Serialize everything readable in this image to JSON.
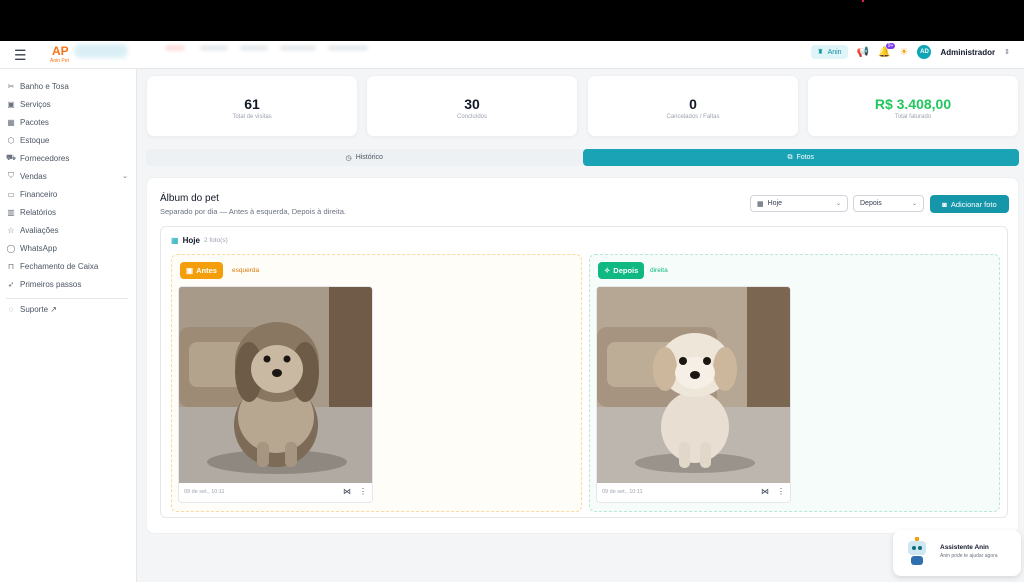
{
  "header": {
    "menu_icon": "menu-icon",
    "logo_mark": "AP",
    "logo_sub": "Anin Pet",
    "anin_chip": "Anin",
    "notif_badge": "9+",
    "avatar_initials": "AD",
    "user_name": "Administrador"
  },
  "sidebar": {
    "items": [
      {
        "label": "Banho e Tosa",
        "icon": "scissors-icon"
      },
      {
        "label": "Serviços",
        "icon": "briefcase-icon"
      },
      {
        "label": "Pacotes",
        "icon": "calendar-icon"
      },
      {
        "label": "Estoque",
        "icon": "box-icon"
      },
      {
        "label": "Fornecedores",
        "icon": "truck-icon"
      },
      {
        "label": "Vendas",
        "icon": "cart-icon"
      },
      {
        "label": "Financeiro",
        "icon": "document-icon"
      },
      {
        "label": "Relatórios",
        "icon": "bar-chart-icon"
      },
      {
        "label": "Avaliações",
        "icon": "star-icon"
      },
      {
        "label": "WhatsApp",
        "icon": "whatsapp-icon"
      },
      {
        "label": "Fechamento de Caixa",
        "icon": "cash-register-icon"
      },
      {
        "label": "Primeiros passos",
        "icon": "rocket-icon"
      }
    ],
    "support": "Suporte ↗"
  },
  "stats": [
    {
      "value": "61",
      "label": "Total de visitas"
    },
    {
      "value": "30",
      "label": "Concluídos"
    },
    {
      "value": "0",
      "label": "Cancelados / Faltas"
    },
    {
      "value": "R$ 3.408,00",
      "label": "Total faturado"
    }
  ],
  "tabs": {
    "historico": "Histórico",
    "fotos": "Fotos"
  },
  "album": {
    "title": "Álbum do pet",
    "subtitle": "Separado por dia — Antes à esquerda, Depois à direita.",
    "filter_day": "Hoje",
    "filter_type": "Depois",
    "add_button": "Adicionar foto",
    "day_label": "Hoje",
    "day_count": "2 foto(s)",
    "antes": {
      "tag": "Antes",
      "side": "esquerda",
      "timestamp": "09 de set., 10:11"
    },
    "depois": {
      "tag": "Depois",
      "side": "direita",
      "timestamp": "09 de set., 10:11"
    }
  },
  "assistant": {
    "name": "Assistente Anin",
    "desc": "Anin pode te ajudar agora"
  },
  "colors": {
    "accent": "#1aa3b5",
    "antes": "#f59e0b",
    "depois": "#10b981",
    "money": "#22c55e"
  }
}
